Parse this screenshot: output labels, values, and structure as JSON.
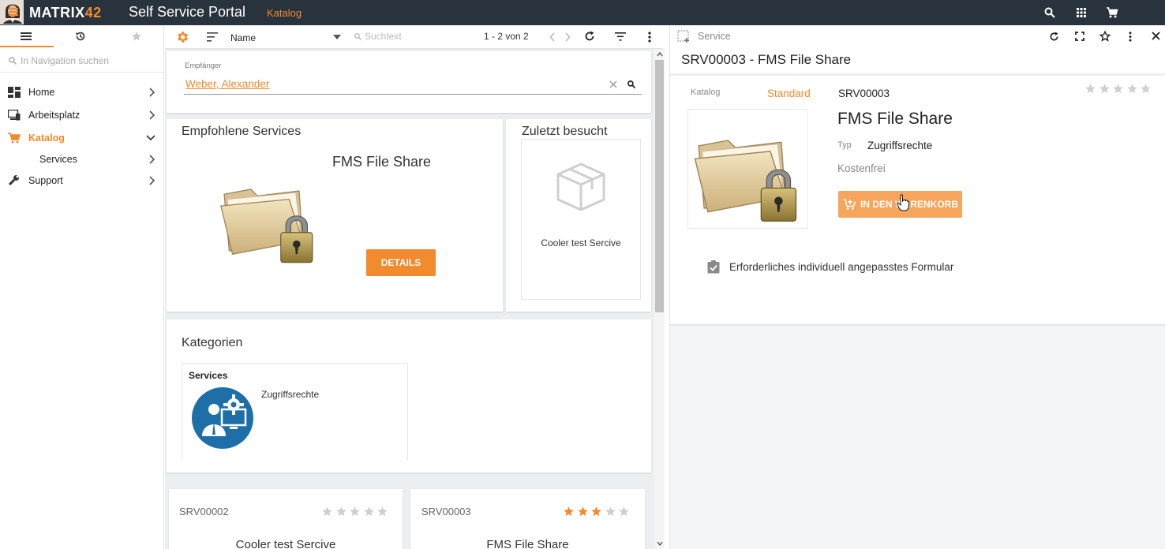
{
  "topbar": {
    "brand_main": "MATRIX",
    "brand_num": "42",
    "app_title": "Self Service Portal",
    "breadcrumb": "Katalog"
  },
  "leftnav": {
    "search_placeholder": "In Navigation suchen",
    "items": [
      {
        "label": "Home"
      },
      {
        "label": "Arbeitsplatz"
      },
      {
        "label": "Katalog"
      },
      {
        "label": "Services"
      },
      {
        "label": "Support"
      }
    ]
  },
  "toolbar": {
    "sort_label": "Name",
    "search_placeholder": "Suchtext",
    "pagination": "1 - 2 von 2"
  },
  "recipient": {
    "label": "Empfänger",
    "value": "Weber, Alexander"
  },
  "recommended": {
    "heading": "Empfohlene Services",
    "service_name": "FMS File Share",
    "details_button": "DETAILS"
  },
  "recent": {
    "heading": "Zuletzt besucht",
    "item_name": "Cooler test Sercive"
  },
  "categories": {
    "heading": "Kategorien",
    "card_title": "Services",
    "card_subtitle": "Zugriffsrechte"
  },
  "list": [
    {
      "id": "SRV00002",
      "name": "Cooler test Sercive",
      "rating": 0
    },
    {
      "id": "SRV00003",
      "name": "FMS File Share",
      "rating": 3
    }
  ],
  "detail": {
    "header_label": "Service",
    "title": "SRV00003 - FMS File Share",
    "catalog_label": "Katalog",
    "catalog_value": "Standard",
    "id": "SRV00003",
    "name": "FMS File Share",
    "type_label": "Typ",
    "type_value": "Zugriffsrechte",
    "price": "Kostenfrei",
    "cart_button": "IN DEN WARENKORB",
    "rating": 0,
    "form_checkbox_label": "Erforderliches individuell angepasstes Formular"
  },
  "colors": {
    "accent": "#f28a2e",
    "topbar": "#29333d",
    "category_icon": "#1e6fa8"
  }
}
